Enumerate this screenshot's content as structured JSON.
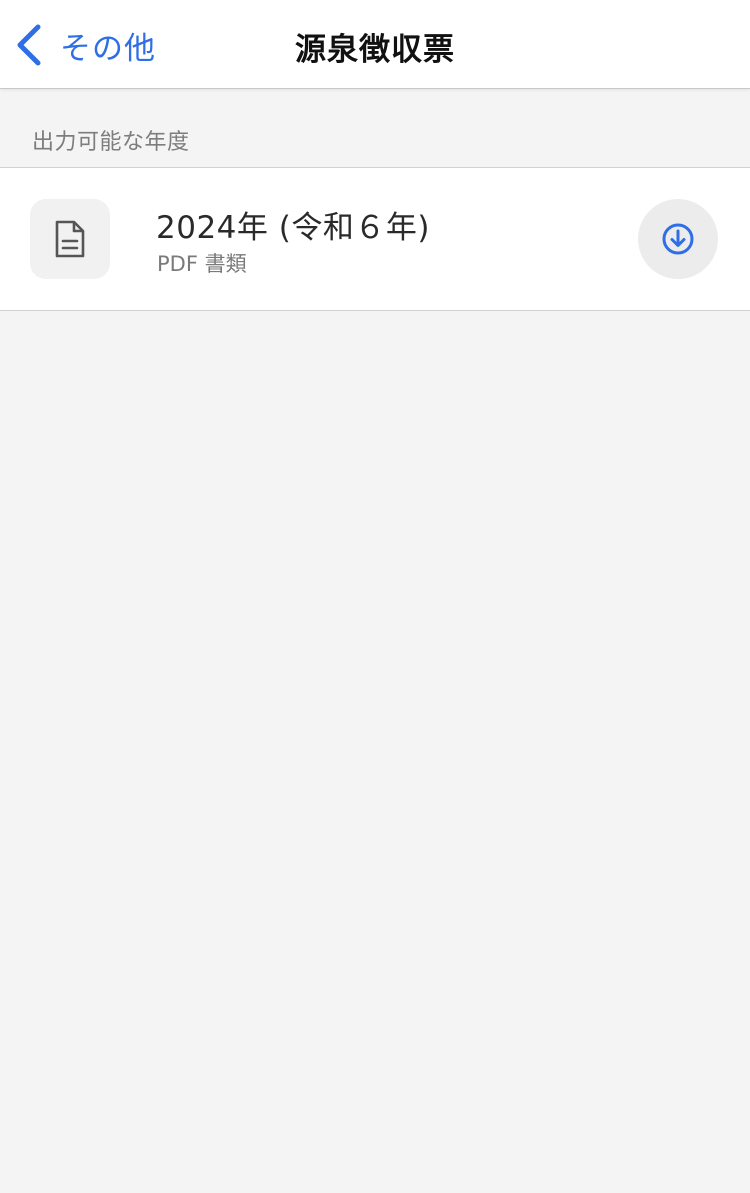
{
  "nav": {
    "back_label": "その他",
    "title": "源泉徴収票",
    "back_icon": "chevron-left-icon"
  },
  "section": {
    "header": "出力可能な年度",
    "items": [
      {
        "title": "2024年 (令和６年)",
        "subtitle": "PDF 書類",
        "leading_icon": "document-icon",
        "trailing_icon": "download-circle-icon"
      }
    ]
  },
  "colors": {
    "accent": "#2f6ee5",
    "background": "#f5f4f5",
    "surface": "#ffffff",
    "secondary_text": "#7a7a7a"
  }
}
